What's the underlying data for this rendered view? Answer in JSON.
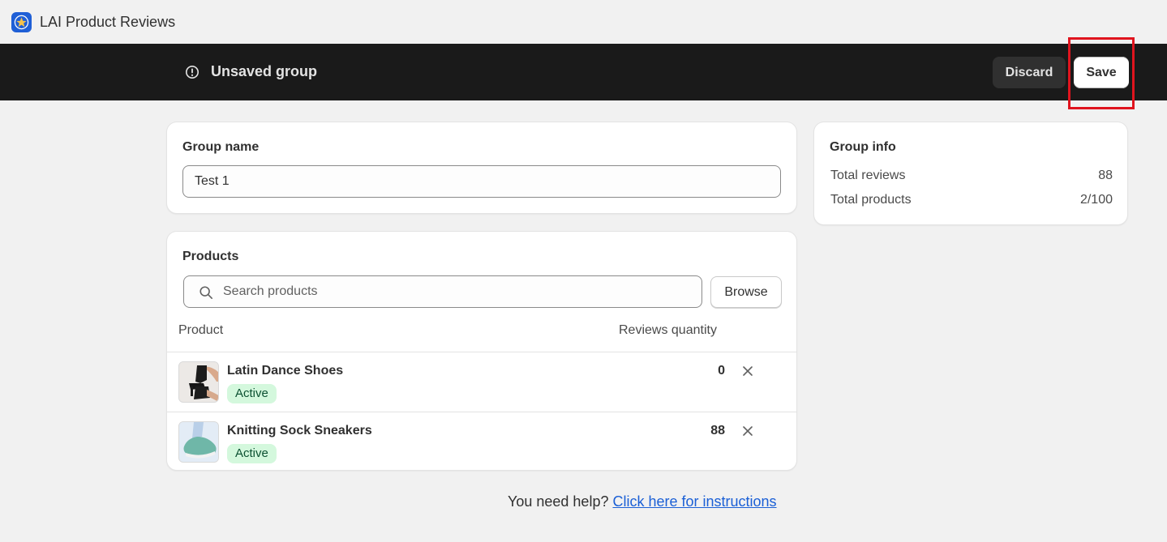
{
  "app": {
    "title": "LAI Product Reviews"
  },
  "save_bar": {
    "title": "Unsaved group",
    "discard_label": "Discard",
    "save_label": "Save"
  },
  "group_name": {
    "label": "Group name",
    "value": "Test 1"
  },
  "products": {
    "title": "Products",
    "search_placeholder": "Search products",
    "browse_label": "Browse",
    "columns": {
      "product": "Product",
      "reviews": "Reviews quantity"
    },
    "rows": [
      {
        "name": "Latin Dance Shoes",
        "status": "Active",
        "reviews": "0"
      },
      {
        "name": "Knitting Sock Sneakers",
        "status": "Active",
        "reviews": "88"
      }
    ]
  },
  "group_info": {
    "title": "Group info",
    "total_reviews_label": "Total reviews",
    "total_reviews_value": "88",
    "total_products_label": "Total products",
    "total_products_value": "2/100"
  },
  "help": {
    "text": "You need help?",
    "link": "Click here for instructions"
  },
  "colors": {
    "brand": "#1f5fd6",
    "bar": "#1a1a1a",
    "badge_bg": "#d4f8dd",
    "badge_text": "#0c5132",
    "highlight": "#e0141e",
    "link": "#1a5fd6"
  },
  "icons": [
    "app-logo-icon",
    "warning-icon",
    "search-icon",
    "close-icon"
  ]
}
